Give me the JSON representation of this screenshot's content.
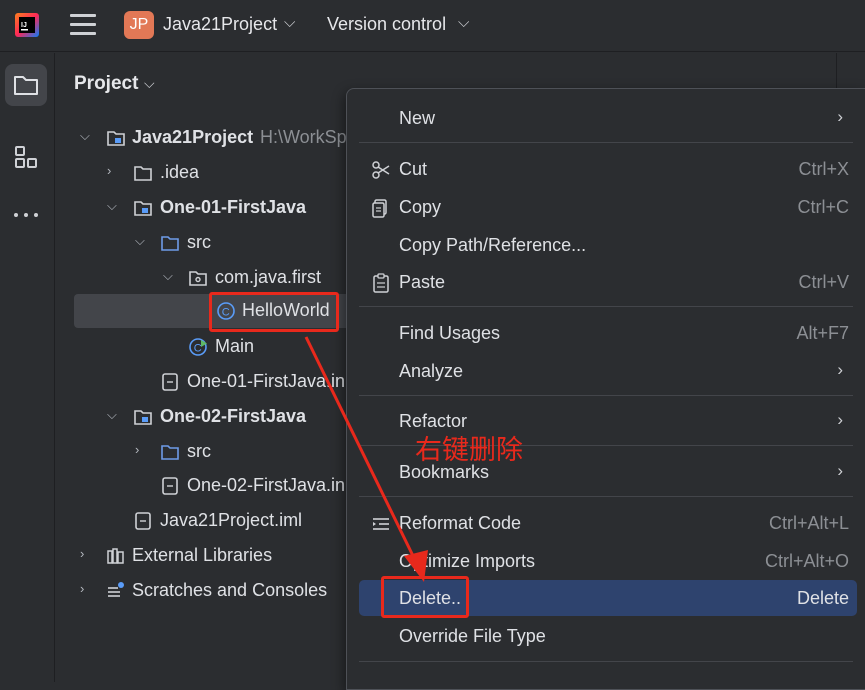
{
  "topbar": {
    "project_badge": "JP",
    "project_name": "Java21Project",
    "vcs": "Version control"
  },
  "panel": {
    "title": "Project"
  },
  "tree": [
    {
      "label": "Java21Project",
      "hint": "H:\\WorkSp",
      "bold": true
    },
    {
      "label": ".idea"
    },
    {
      "label": "One-01-FirstJava",
      "bold": true
    },
    {
      "label": "src"
    },
    {
      "label": "com.java.first"
    },
    {
      "label": "HelloWorld"
    },
    {
      "label": "Main"
    },
    {
      "label": "One-01-FirstJava.in"
    },
    {
      "label": "One-02-FirstJava",
      "bold": true
    },
    {
      "label": "src"
    },
    {
      "label": "One-02-FirstJava.in"
    },
    {
      "label": "Java21Project.iml"
    },
    {
      "label": "External Libraries"
    },
    {
      "label": "Scratches and Consoles"
    }
  ],
  "context_menu": {
    "new": "New",
    "cut": "Cut",
    "cut_sc": "Ctrl+X",
    "copy": "Copy",
    "copy_sc": "Ctrl+C",
    "copy_path": "Copy Path/Reference...",
    "paste": "Paste",
    "paste_sc": "Ctrl+V",
    "find_usages": "Find Usages",
    "find_usages_sc": "Alt+F7",
    "analyze": "Analyze",
    "refactor": "Refactor",
    "bookmarks": "Bookmarks",
    "reformat": "Reformat Code",
    "reformat_sc": "Ctrl+Alt+L",
    "optimize": "Optimize Imports",
    "optimize_sc": "Ctrl+Alt+O",
    "delete": "Delete..",
    "delete_sc": "Delete",
    "override": "Override File Type"
  },
  "annotation": {
    "text": "右键删除",
    "color": "#e8291c"
  },
  "colors": {
    "accent": "#2e436e",
    "folder_blue": "#6e9be8",
    "class_blue": "#5a9cf8"
  }
}
